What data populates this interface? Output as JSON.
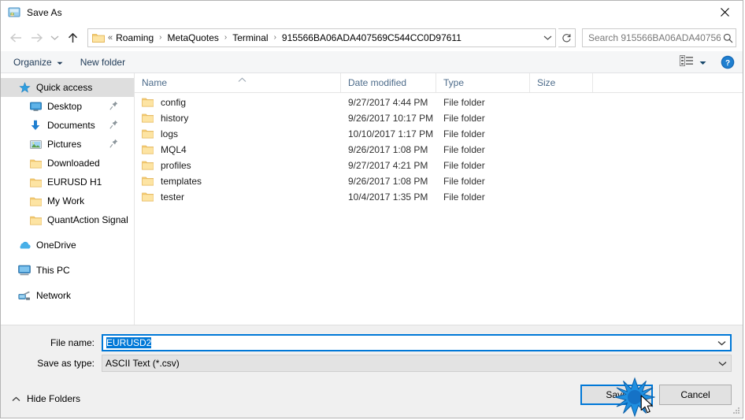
{
  "window": {
    "title": "Save As",
    "icon": "save-as-icon",
    "close_label": "✕"
  },
  "navigation": {
    "back": "back-arrow",
    "forward": "forward-arrow",
    "recent": "recent-locations-chevron",
    "up": "up-arrow",
    "breadcrumb_prefix": "«",
    "breadcrumbs": [
      "Roaming",
      "MetaQuotes",
      "Terminal",
      "915566BA06ADA407569C544CC0D97611"
    ],
    "separator": "›",
    "dropdown": "chevron-down-icon",
    "refresh": "refresh-icon"
  },
  "search": {
    "placeholder": "Search 915566BA06ADA40756...",
    "icon": "search-icon"
  },
  "toolbar": {
    "organize_label": "Organize",
    "new_folder_label": "New folder",
    "view_icon": "view-list-icon",
    "view_caret": "chevron-down-icon",
    "help_label": "?"
  },
  "sidebar": {
    "items": [
      {
        "label": "Quick access",
        "icon": "star-icon",
        "selected": true,
        "indent": false,
        "pinned": false
      },
      {
        "label": "Desktop",
        "icon": "desktop-icon",
        "selected": false,
        "indent": true,
        "pinned": true
      },
      {
        "label": "Documents",
        "icon": "documents-icon",
        "selected": false,
        "indent": true,
        "pinned": true
      },
      {
        "label": "Pictures",
        "icon": "pictures-icon",
        "selected": false,
        "indent": true,
        "pinned": true
      },
      {
        "label": "Downloaded",
        "icon": "folder-icon",
        "selected": false,
        "indent": true,
        "pinned": false
      },
      {
        "label": "EURUSD H1",
        "icon": "folder-icon",
        "selected": false,
        "indent": true,
        "pinned": false
      },
      {
        "label": "My Work",
        "icon": "folder-icon",
        "selected": false,
        "indent": true,
        "pinned": false
      },
      {
        "label": "QuantAction Signal",
        "icon": "folder-icon",
        "selected": false,
        "indent": true,
        "pinned": false
      },
      {
        "label": "OneDrive",
        "icon": "onedrive-icon",
        "selected": false,
        "indent": false,
        "pinned": false,
        "gap_before": true
      },
      {
        "label": "This PC",
        "icon": "this-pc-icon",
        "selected": false,
        "indent": false,
        "pinned": false,
        "gap_before": true
      },
      {
        "label": "Network",
        "icon": "network-icon",
        "selected": false,
        "indent": false,
        "pinned": false,
        "gap_before": true
      }
    ]
  },
  "filelist": {
    "columns": [
      "Name",
      "Date modified",
      "Type",
      "Size"
    ],
    "sort_column": "Name",
    "sort_direction": "ascending",
    "rows": [
      {
        "name": "config",
        "date": "9/27/2017 4:44 PM",
        "type": "File folder",
        "size": ""
      },
      {
        "name": "history",
        "date": "9/26/2017 10:17 PM",
        "type": "File folder",
        "size": ""
      },
      {
        "name": "logs",
        "date": "10/10/2017 1:17 PM",
        "type": "File folder",
        "size": ""
      },
      {
        "name": "MQL4",
        "date": "9/26/2017 1:08 PM",
        "type": "File folder",
        "size": ""
      },
      {
        "name": "profiles",
        "date": "9/27/2017 4:21 PM",
        "type": "File folder",
        "size": ""
      },
      {
        "name": "templates",
        "date": "9/26/2017 1:08 PM",
        "type": "File folder",
        "size": ""
      },
      {
        "name": "tester",
        "date": "10/4/2017 1:35 PM",
        "type": "File folder",
        "size": ""
      }
    ]
  },
  "form": {
    "filename_label": "File name:",
    "filename_value": "EURUSD2",
    "filename_selected": true,
    "filetype_label": "Save as type:",
    "filetype_value": "ASCII Text (*.csv)"
  },
  "buttons": {
    "save": "Save",
    "cancel": "Cancel",
    "hide_folders": "Hide Folders"
  },
  "colors": {
    "accent": "#0078d7",
    "folder": "#fcd77f",
    "selection": "#dedede",
    "header_text": "#4c6b8a",
    "footer_bg": "#f0f0f0"
  }
}
